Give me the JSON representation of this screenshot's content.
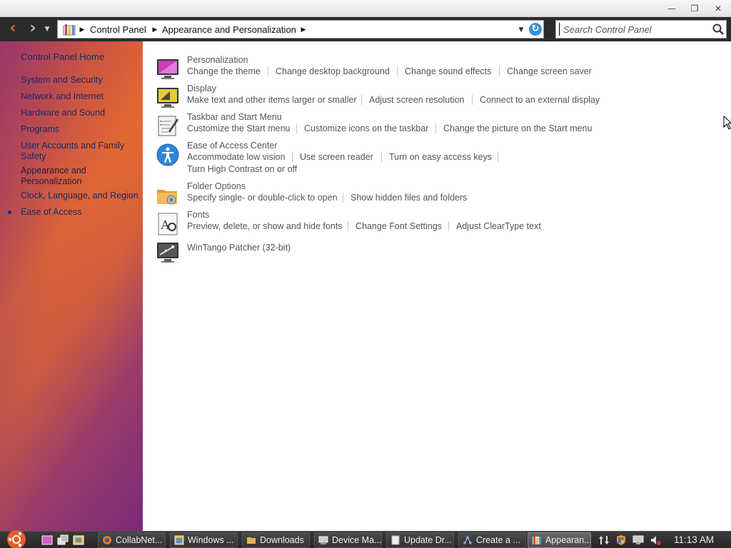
{
  "window": {
    "minimize_glyph": "—",
    "restore_glyph": "❐",
    "close_glyph": "✕"
  },
  "nav": {
    "back_glyph": "‹",
    "forward_glyph": "›",
    "history_glyph": "▼",
    "breadcrumb": [
      "Control Panel",
      "Appearance and Personalization"
    ],
    "refresh_glyph": "↻",
    "search_placeholder": "Search Control Panel"
  },
  "sidebar": {
    "home": "Control Panel Home",
    "items": [
      "System and Security",
      "Network and Internet",
      "Hardware and Sound",
      "Programs",
      "User Accounts and Family Safety",
      "Appearance and Personalization",
      "Clock, Language, and Region",
      "Ease of Access"
    ],
    "current_index": 5
  },
  "categories": [
    {
      "title": "Personalization",
      "icon": "personalization-icon",
      "links": [
        "Change the theme",
        "Change desktop background",
        "Change sound effects",
        "Change screen saver"
      ]
    },
    {
      "title": "Display",
      "icon": "display-icon",
      "links": [
        "Make text and other items larger or smaller",
        "Adjust screen resolution",
        "Connect to an external display"
      ]
    },
    {
      "title": "Taskbar and Start Menu",
      "icon": "taskbar-icon",
      "links": [
        "Customize the Start menu",
        "Customize icons on the taskbar",
        "Change the picture on the Start menu"
      ]
    },
    {
      "title": "Ease of Access Center",
      "icon": "ease-of-access-icon",
      "links": [
        "Accommodate low vision",
        "Use screen reader",
        "Turn on easy access keys",
        "Turn High Contrast on or off"
      ]
    },
    {
      "title": "Folder Options",
      "icon": "folder-options-icon",
      "links": [
        "Specify single- or double-click to open",
        "Show hidden files and folders"
      ]
    },
    {
      "title": "Fonts",
      "icon": "fonts-icon",
      "links": [
        "Preview, delete, or show and hide fonts",
        "Change Font Settings",
        "Adjust ClearType text"
      ]
    },
    {
      "title": "WinTango Patcher (32-bit)",
      "icon": "wintango-icon",
      "links": []
    }
  ],
  "taskbar": {
    "tasks": [
      "CollabNet...",
      "Windows ...",
      "Downloads",
      "Device Ma...",
      "Update Dr...",
      "Create a ...",
      "Appearan..."
    ],
    "active_index": 6,
    "clock": "11:13 AM"
  },
  "colors": {
    "sidebar_link": "#1a2a6a",
    "content_text": "#555555",
    "back_arrow": "#e0662a",
    "taskbar_bg": "#2e2e2e"
  }
}
